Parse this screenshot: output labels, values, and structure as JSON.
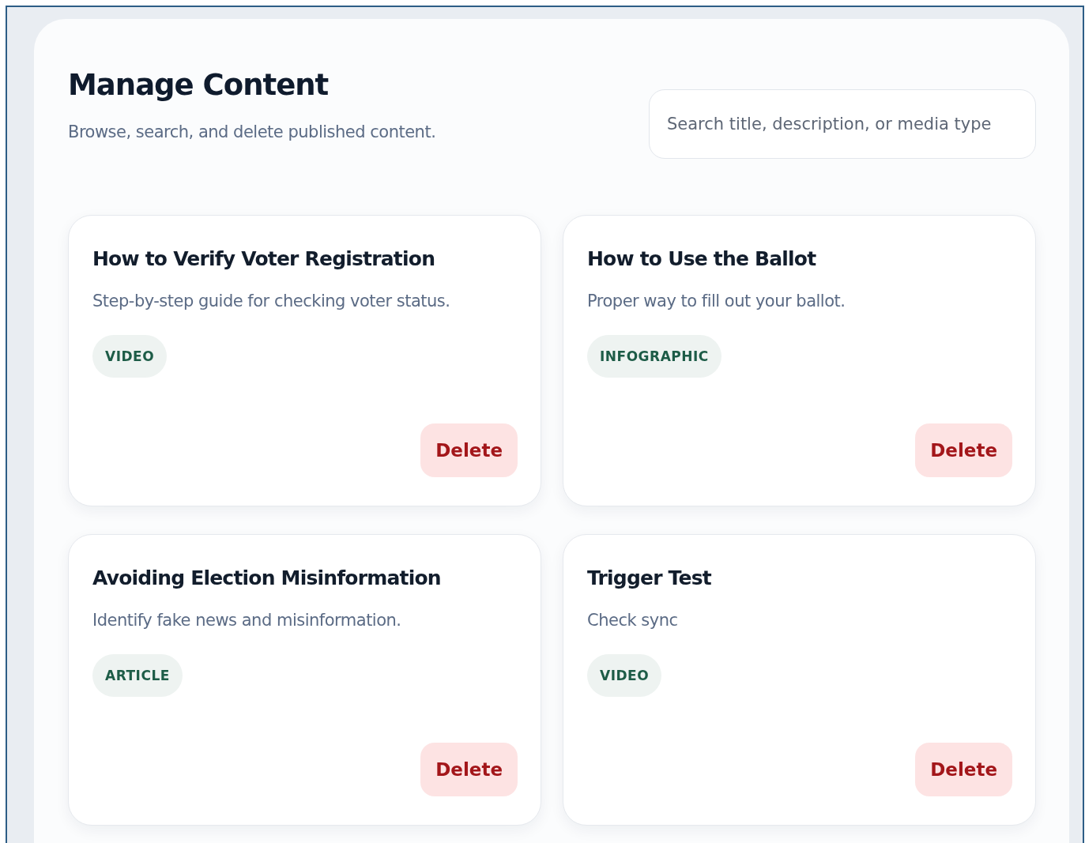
{
  "header": {
    "title": "Manage Content",
    "subtitle": "Browse, search, and delete published content."
  },
  "search": {
    "placeholder": "Search title, description, or media type"
  },
  "items": [
    {
      "title": "How to Verify Voter Registration",
      "description": "Step-by-step guide for checking voter status.",
      "media_type": "VIDEO",
      "action": "Delete"
    },
    {
      "title": "How to Use the Ballot",
      "description": "Proper way to fill out your ballot.",
      "media_type": "INFOGRAPHIC",
      "action": "Delete"
    },
    {
      "title": "Avoiding Election Misinformation",
      "description": "Identify fake news and misinformation.",
      "media_type": "ARTICLE",
      "action": "Delete"
    },
    {
      "title": "Trigger Test",
      "description": "Check sync",
      "media_type": "VIDEO",
      "action": "Delete"
    }
  ]
}
